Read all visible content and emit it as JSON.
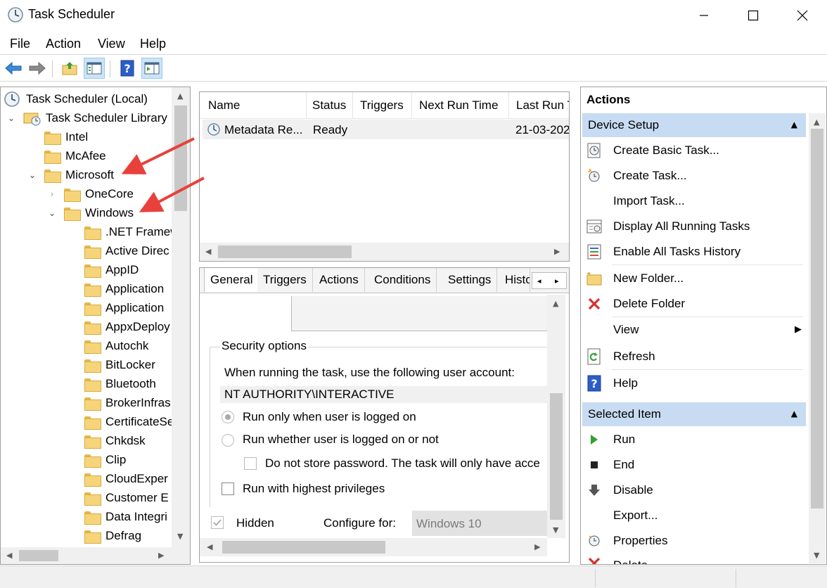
{
  "window": {
    "title": "Task Scheduler"
  },
  "menu": [
    "File",
    "Action",
    "View",
    "Help"
  ],
  "toolbar": {
    "icons": [
      "back-arrow-icon",
      "forward-arrow-icon",
      "up-folder-icon",
      "show-hide-console-tree-icon",
      "help-icon",
      "show-hide-action-pane-icon"
    ]
  },
  "tree": {
    "root": "Task Scheduler (Local)",
    "library": "Task Scheduler Library",
    "items": [
      "Intel",
      "McAfee",
      "Microsoft",
      "OneCore",
      "Windows",
      ".NET Framew",
      "Active Direc",
      "AppID",
      "Application",
      "Application",
      "AppxDeploy",
      "Autochk",
      "BitLocker",
      "Bluetooth",
      "BrokerInfras",
      "CertificateSe",
      "Chkdsk",
      "Clip",
      "CloudExper",
      "Customer E",
      "Data Integri",
      "Defrag"
    ]
  },
  "task_list": {
    "columns": [
      "Name",
      "Status",
      "Triggers",
      "Next Run Time",
      "Last Run T"
    ],
    "rows": [
      {
        "name": "Metadata Re...",
        "status": "Ready",
        "triggers": "",
        "next_run": "",
        "last_run": "21-03-202"
      }
    ]
  },
  "details": {
    "tabs": [
      "General",
      "Triggers",
      "Actions",
      "Conditions",
      "Settings",
      "Histo"
    ],
    "security_title": "Security options",
    "account_prompt": "When running the task, use the following user account:",
    "account": "NT AUTHORITY\\INTERACTIVE",
    "radio_logged_on": "Run only when user is logged on",
    "radio_whether": "Run whether user is logged on or not",
    "no_store_password": "Do not store password.  The task will only have acce",
    "highest_privileges": "Run with highest privileges",
    "hidden_label": "Hidden",
    "configure_label": "Configure for:",
    "configure_value": "Windows 10"
  },
  "actions": {
    "title": "Actions",
    "device_setup": "Device Setup",
    "device_items": [
      "Create Basic Task...",
      "Create Task...",
      "Import Task...",
      "Display All Running Tasks",
      "Enable All Tasks History",
      "New Folder...",
      "Delete Folder",
      "View",
      "Refresh",
      "Help"
    ],
    "selected_item": "Selected Item",
    "selected_items": [
      "Run",
      "End",
      "Disable",
      "Export...",
      "Properties",
      "Delete"
    ]
  },
  "colors": {
    "header_blue": "#c7dcf2",
    "arrow_red": "#e8413c",
    "folder_yellow": "#f6d57a"
  }
}
